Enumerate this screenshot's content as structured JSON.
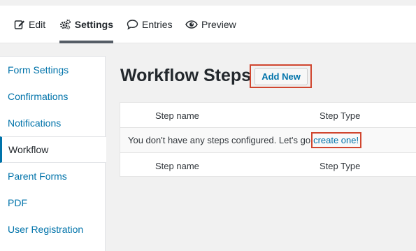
{
  "toolbar": {
    "items": [
      {
        "label": "Edit",
        "icon": "edit-icon"
      },
      {
        "label": "Settings",
        "icon": "gears-icon",
        "active": true
      },
      {
        "label": "Entries",
        "icon": "comment-icon"
      },
      {
        "label": "Preview",
        "icon": "eye-icon"
      }
    ]
  },
  "sidebar": {
    "items": [
      {
        "label": "Form Settings"
      },
      {
        "label": "Confirmations"
      },
      {
        "label": "Notifications"
      },
      {
        "label": "Workflow",
        "active": true
      },
      {
        "label": "Parent Forms"
      },
      {
        "label": "PDF"
      },
      {
        "label": "User Registration"
      }
    ]
  },
  "main": {
    "title": "Workflow Steps",
    "add_new_label": "Add New",
    "table": {
      "columns": [
        "Step name",
        "Step Type"
      ],
      "empty_message": "You don't have any steps configured. Let's go",
      "create_link": "create one",
      "create_suffix": "!"
    }
  },
  "colors": {
    "accent": "#0073aa",
    "highlight": "#d0462f",
    "active_underline": "#555d66"
  }
}
